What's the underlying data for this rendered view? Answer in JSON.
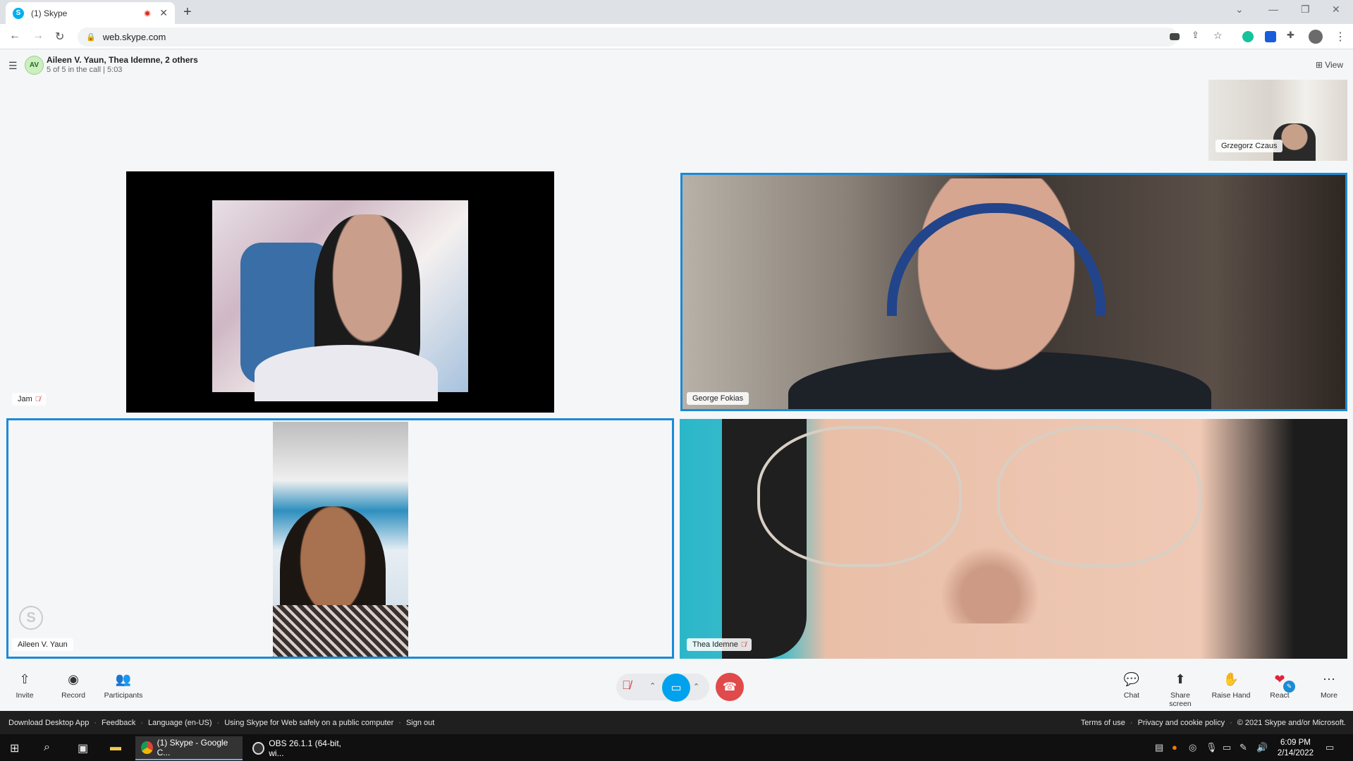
{
  "browser": {
    "tab_title": "(1) Skype",
    "tab_favicon_letter": "S",
    "url": "web.skype.com",
    "icons": [
      "back-icon",
      "forward-icon",
      "reload-icon",
      "lock-icon",
      "camera-icon",
      "share-icon",
      "star-icon",
      "grammarly-icon",
      "bitwarden-icon",
      "extensions-icon",
      "profile-icon",
      "menu-icon"
    ]
  },
  "call": {
    "avatar_initials": "AV",
    "title": "Aileen V. Yaun, Thea Idemne, 2 others",
    "subtitle": "5 of 5 in the call | 5:03",
    "view_label": "View"
  },
  "participants": {
    "gregorz": "Grzegorz Czaus",
    "jam": "Jam",
    "george": "George Fokias",
    "aileen": "Aileen V. Yaun",
    "thea": "Thea Idemne"
  },
  "controls": {
    "invite": "Invite",
    "record": "Record",
    "participants": "Participants",
    "chat": "Chat",
    "share_screen": "Share screen",
    "raise_hand": "Raise Hand",
    "react": "React",
    "more": "More"
  },
  "footer": {
    "left": [
      "Download Desktop App",
      "Feedback",
      "Language (en-US)",
      "Using Skype for Web safely on a public computer",
      "Sign out"
    ],
    "right": [
      "Terms of use",
      "Privacy and cookie policy",
      "© 2021 Skype and/or Microsoft."
    ]
  },
  "taskbar": {
    "chrome_label": "(1) Skype - Google C...",
    "obs_label": "OBS 26.1.1 (64-bit, wi...",
    "time": "6:09 PM",
    "date": "2/14/2022"
  },
  "colors": {
    "accent": "#1a8bd6",
    "camera_on": "#00a2ed",
    "hangup": "#e04a4a",
    "muted": "#d43b3b"
  }
}
